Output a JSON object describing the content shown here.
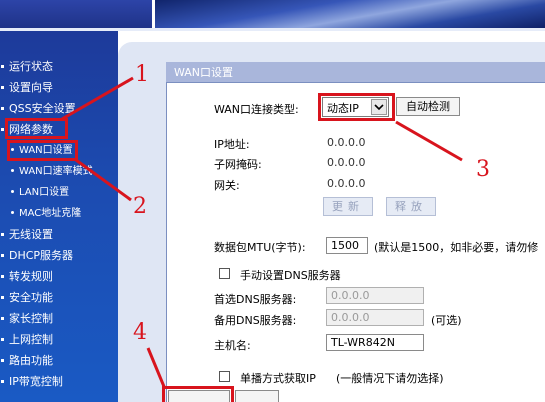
{
  "sidebar": {
    "items": [
      {
        "label": "运行状态"
      },
      {
        "label": "设置向导"
      },
      {
        "label": "QSS安全设置"
      },
      {
        "label": "网络参数"
      },
      {
        "label": "WAN口设置"
      },
      {
        "label": "WAN口速率模式"
      },
      {
        "label": "LAN口设置"
      },
      {
        "label": "MAC地址克隆"
      },
      {
        "label": "无线设置"
      },
      {
        "label": "DHCP服务器"
      },
      {
        "label": "转发规则"
      },
      {
        "label": "安全功能"
      },
      {
        "label": "家长控制"
      },
      {
        "label": "上网控制"
      },
      {
        "label": "路由功能"
      },
      {
        "label": "IP带宽控制"
      }
    ]
  },
  "panel": {
    "title": "WAN口设置",
    "connection_type_label": "WAN口连接类型:",
    "connection_type_value": "动态IP",
    "auto_detect_button": "自动检测",
    "ip_label": "IP地址:",
    "ip_value": "0.0.0.0",
    "mask_label": "子网掩码:",
    "mask_value": "0.0.0.0",
    "gateway_label": "网关:",
    "gateway_value": "0.0.0.0",
    "renew_button": "更新",
    "release_button": "释放",
    "mtu_label": "数据包MTU(字节):",
    "mtu_value": "1500",
    "mtu_hint": "(默认是1500，如非必要，请勿修",
    "manual_dns_label": "手动设置DNS服务器",
    "primary_dns_label": "首选DNS服务器:",
    "primary_dns_value": "0.0.0.0",
    "secondary_dns_label": "备用DNS服务器:",
    "secondary_dns_value": "0.0.0.0",
    "secondary_dns_hint": "(可选)",
    "hostname_label": "主机名:",
    "hostname_value": "TL-WR842N",
    "unicast_label": "单播方式获取IP",
    "unicast_hint": "(一般情况下请勿选择)"
  },
  "annotations": {
    "num1": "1",
    "num2": "2",
    "num3": "3",
    "num4": "4",
    "color": "#d8141d"
  }
}
